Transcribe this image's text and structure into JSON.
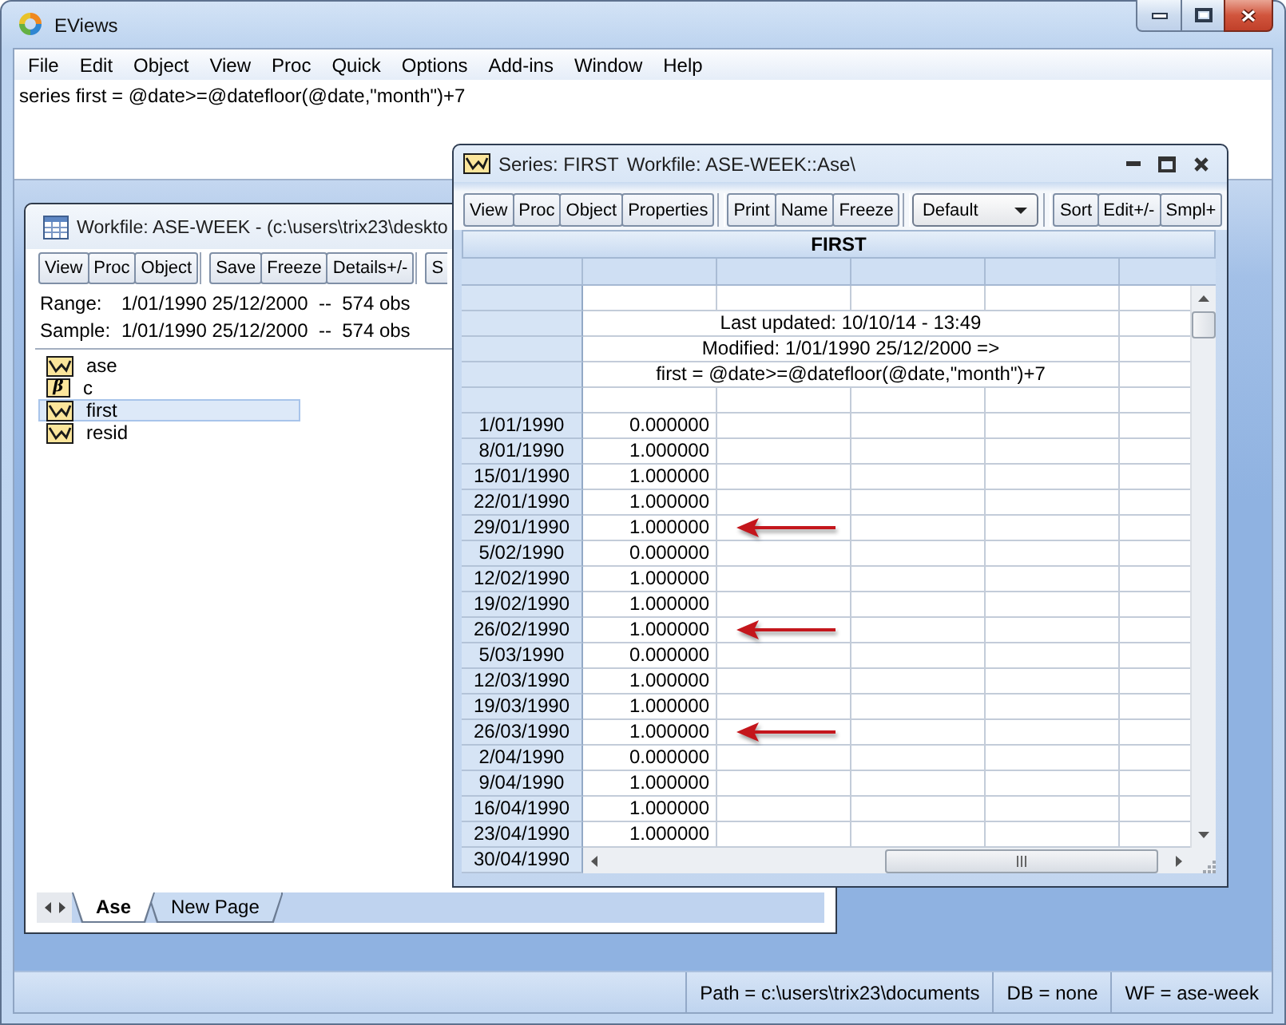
{
  "window": {
    "title": "EViews"
  },
  "menu": [
    "File",
    "Edit",
    "Object",
    "View",
    "Proc",
    "Quick",
    "Options",
    "Add-ins",
    "Window",
    "Help"
  ],
  "command_window": {
    "value": "series first = @date>=@datefloor(@date,\"month\")+7"
  },
  "workfile_window": {
    "title": "Workfile: ASE-WEEK - (c:\\users\\trix23\\deskto",
    "toolbar": [
      [
        "View",
        "Proc",
        "Object"
      ],
      [
        "Save",
        "Freeze",
        "Details+/-"
      ],
      [
        "S"
      ]
    ],
    "info": [
      {
        "label": "Range:",
        "value": "1/01/1990 25/12/2000  --  574 obs"
      },
      {
        "label": "Sample:",
        "value": "1/01/1990 25/12/2000  --  574 obs"
      }
    ],
    "objects": [
      {
        "name": "ase",
        "kind": "series",
        "selected": false
      },
      {
        "name": "c",
        "kind": "coef",
        "glyph": "β",
        "selected": false
      },
      {
        "name": "first",
        "kind": "series",
        "selected": true
      },
      {
        "name": "resid",
        "kind": "series",
        "selected": false
      }
    ],
    "page_tabs": [
      {
        "label": "Ase",
        "selected": true
      },
      {
        "label": "New Page",
        "selected": false
      }
    ]
  },
  "series_window": {
    "title": "Series: FIRST",
    "workfile": "Workfile: ASE-WEEK::Ase\\",
    "toolbar": [
      [
        {
          "kind": "button",
          "label": "View"
        },
        {
          "kind": "button",
          "label": "Proc"
        },
        {
          "kind": "button",
          "label": "Object"
        },
        {
          "kind": "button",
          "label": "Properties"
        }
      ],
      [
        {
          "kind": "button",
          "label": "Print"
        },
        {
          "kind": "button",
          "label": "Name"
        },
        {
          "kind": "button",
          "label": "Freeze"
        }
      ],
      [
        {
          "kind": "dropdown",
          "value": "Default"
        }
      ],
      [
        {
          "kind": "button",
          "label": "Sort"
        },
        {
          "kind": "button",
          "label": "Edit+/-"
        },
        {
          "kind": "button",
          "label": "Smpl+"
        }
      ]
    ],
    "table": {
      "title": "FIRST",
      "notes": [
        "Last updated: 10/10/14 - 13:49",
        "Modified: 1/01/1990 25/12/2000 =>",
        "first = @date>=@datefloor(@date,\"month\")+7"
      ],
      "rows": [
        {
          "date": "1/01/1990",
          "value": "0.000000",
          "marked": false
        },
        {
          "date": "8/01/1990",
          "value": "1.000000",
          "marked": false
        },
        {
          "date": "15/01/1990",
          "value": "1.000000",
          "marked": false
        },
        {
          "date": "22/01/1990",
          "value": "1.000000",
          "marked": false
        },
        {
          "date": "29/01/1990",
          "value": "1.000000",
          "marked": true
        },
        {
          "date": "5/02/1990",
          "value": "0.000000",
          "marked": false
        },
        {
          "date": "12/02/1990",
          "value": "1.000000",
          "marked": false
        },
        {
          "date": "19/02/1990",
          "value": "1.000000",
          "marked": false
        },
        {
          "date": "26/02/1990",
          "value": "1.000000",
          "marked": true
        },
        {
          "date": "5/03/1990",
          "value": "0.000000",
          "marked": false
        },
        {
          "date": "12/03/1990",
          "value": "1.000000",
          "marked": false
        },
        {
          "date": "19/03/1990",
          "value": "1.000000",
          "marked": false
        },
        {
          "date": "26/03/1990",
          "value": "1.000000",
          "marked": true
        },
        {
          "date": "2/04/1990",
          "value": "0.000000",
          "marked": false
        },
        {
          "date": "9/04/1990",
          "value": "1.000000",
          "marked": false
        },
        {
          "date": "16/04/1990",
          "value": "1.000000",
          "marked": false
        },
        {
          "date": "23/04/1990",
          "value": "1.000000",
          "marked": false
        },
        {
          "date": "30/04/1990"
        }
      ]
    }
  },
  "status_bar": [
    "Path = c:\\users\\trix23\\documents",
    "DB = none",
    "WF = ase-week"
  ]
}
